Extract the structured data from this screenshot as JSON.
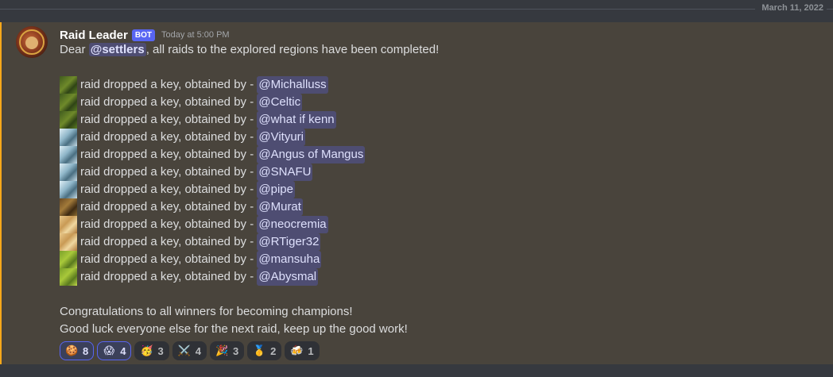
{
  "divider": {
    "date": "March 11, 2022"
  },
  "message": {
    "author": "Raid Leader",
    "bot_tag": "BOT",
    "timestamp": "Today at 5:00 PM",
    "intro_prefix": "Dear ",
    "intro_mention": "@settlers",
    "intro_suffix": ", all raids to the explored regions have been completed!",
    "raid_text": "raid dropped a key, obtained by - ",
    "raids": [
      {
        "icon": "forest",
        "winner": "@Michalluss"
      },
      {
        "icon": "forest",
        "winner": "@Celtic"
      },
      {
        "icon": "forest",
        "winner": "@what if kenn"
      },
      {
        "icon": "ice",
        "winner": "@Vityuri"
      },
      {
        "icon": "ice",
        "winner": "@Angus of Mangus"
      },
      {
        "icon": "ice",
        "winner": "@SNAFU"
      },
      {
        "icon": "ice",
        "winner": "@pipe"
      },
      {
        "icon": "desert",
        "winner": "@Murat"
      },
      {
        "icon": "sand",
        "winner": "@neocremia"
      },
      {
        "icon": "sand",
        "winner": "@RTiger32"
      },
      {
        "icon": "grass",
        "winner": "@mansuha"
      },
      {
        "icon": "grass",
        "winner": "@Abysmal"
      }
    ],
    "closing_1": "Congratulations to all winners for becoming champions!",
    "closing_2": "Good luck everyone else for the next raid, keep up the good work!"
  },
  "reactions": [
    {
      "emoji": "🍪",
      "count": "8",
      "me": true
    },
    {
      "emoji": "😱",
      "count": "4",
      "me": true
    },
    {
      "emoji": "🥳",
      "count": "3",
      "me": false
    },
    {
      "emoji": "⚔️",
      "count": "4",
      "me": false
    },
    {
      "emoji": "🎉",
      "count": "3",
      "me": false
    },
    {
      "emoji": "🥇",
      "count": "2",
      "me": false
    },
    {
      "emoji": "🍻",
      "count": "1",
      "me": false
    }
  ],
  "colors": {
    "background": "#36393f",
    "message_highlight": "#49443c",
    "mention_bar": "#faa81a",
    "bot_tag": "#5865f2"
  }
}
